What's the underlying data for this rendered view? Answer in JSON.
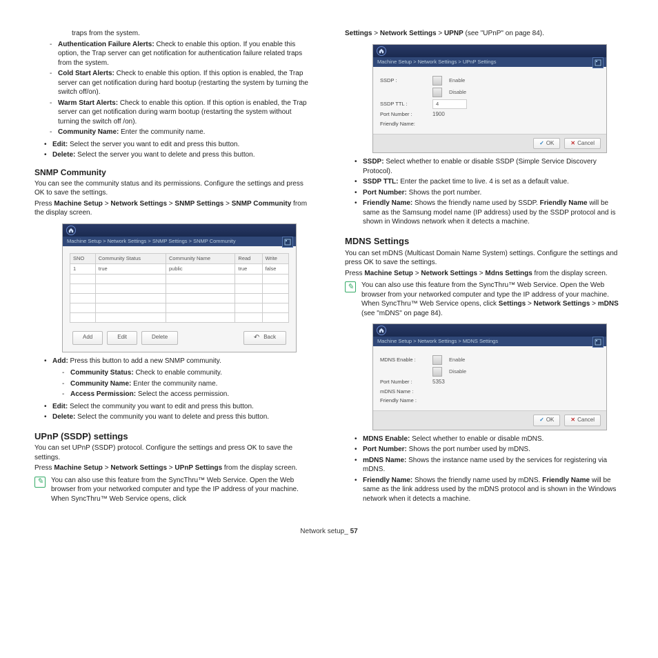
{
  "left": {
    "traps_from_system": "traps from the system.",
    "dash1": [
      {
        "b": "Authentication Failure Alerts:",
        "t": "  Check to enable this option. If you enable this option, the Trap server can get notification for authentication failure related traps from the system."
      },
      {
        "b": "Cold Start Alerts:",
        "t": "  Check to enable this option. If this option is enabled, the Trap server can get notification during hard bootup (restarting the system by turning the switch off/on)."
      },
      {
        "b": "Warm Start Alerts:",
        "t": "  Check to enable this option. If this option is enabled, the Trap server can get notification during warm bootup (restarting the system without turning the switch off /on)."
      },
      {
        "b": "Community Name:",
        "t": "  Enter the community name."
      }
    ],
    "bul1": [
      {
        "b": "Edit:",
        "t": "  Select the server you want to edit and press this button."
      },
      {
        "b": "Delete:",
        "t": "  Select the server you want to delete and press this button."
      }
    ],
    "snmp_h": "SNMP Community",
    "snmp_p1": "You can see the community status and its permissions. Configure the settings and press OK to save the settings.",
    "snmp_p2_pre": "Press ",
    "snmp_p2_b1": "Machine Setup",
    "snmp_p2_s1": " > ",
    "snmp_p2_b2": "Network Settings",
    "snmp_p2_s2": " > ",
    "snmp_p2_b3": "SNMP Settings",
    "snmp_p2_s3": " > ",
    "snmp_p2_b4": "SNMP Community",
    "snmp_p2_post": " from the display screen.",
    "snmp_mock": {
      "crumb": "Machine Setup  >  Network Settings  >  SNMP Settings  >  SNMP Community",
      "headers": [
        "SNO",
        "Community Status",
        "Community Name",
        "Read",
        "Write"
      ],
      "row1": [
        "1",
        "true",
        "public",
        "true",
        "false"
      ],
      "btns": [
        "Add",
        "Edit",
        "Delete"
      ],
      "back": "Back"
    },
    "bul2": [
      {
        "b": "Add:",
        "t": "  Press this button to add a new SNMP community."
      }
    ],
    "dash2": [
      {
        "b": "Community Status:",
        "t": "  Check to enable community."
      },
      {
        "b": "Community Name:",
        "t": "  Enter the community name."
      },
      {
        "b": "Access Permission:",
        "t": "  Select the access permission."
      }
    ],
    "bul3": [
      {
        "b": "Edit:",
        "t": "  Select the community you want to edit and press this button."
      },
      {
        "b": "Delete:",
        "t": "  Select the community you want to delete and press this button."
      }
    ],
    "upnp_h": "UPnP (SSDP) settings",
    "upnp_p1": "You can set UPnP (SSDP) protocol. Configure the settings and press OK to save the settings.",
    "upnp_p2_pre": "Press ",
    "upnp_p2_b1": "Machine Setup",
    "upnp_p2_s1": " > ",
    "upnp_p2_b2": "Network Settings",
    "upnp_p2_s2": " > ",
    "upnp_p2_b3": "UPnP Settings",
    "upnp_p2_post": " from the display screen.",
    "upnp_note": "You can also use this feature from the SyncThru™ Web Service. Open the Web browser from your networked computer and type the IP address of your machine. When SyncThru™ Web Service opens, click "
  },
  "right": {
    "top_b1": "Settings",
    "top_s1": " > ",
    "top_b2": "Network Settings",
    "top_s2": " > ",
    "top_b3": "UPNP",
    "top_post": " (see \"UPnP\" on page 84).",
    "upnp_mock": {
      "crumb": "Machine Setup  >  Network Settings  >  UPnP Settings",
      "rows": [
        {
          "label": "SSDP :",
          "opts": [
            "Enable",
            "Disable"
          ]
        },
        {
          "label": "SSDP TTL :",
          "val": "4"
        },
        {
          "label": "Port Number :",
          "val": "1900"
        },
        {
          "label": "Friendly Name:",
          "val": ""
        }
      ],
      "ok": "OK",
      "cancel": "Cancel"
    },
    "bul1": [
      {
        "b": "SSDP:",
        "t": "  Select whether to enable or disable SSDP (Simple Service Discovery Protocol)."
      },
      {
        "b": "SSDP TTL:",
        "t": "  Enter the packet time to live. 4 is set as a default value."
      },
      {
        "b": "Port Number:",
        "t": "  Shows the port number."
      },
      {
        "b": "Friendly Name:",
        "t": "  Shows the friendly name used by SSDP. ",
        "b2": "Friendly Name",
        "t2": " will be same as the Samsung model name (IP address) used by the SSDP protocol and is shown in Windows network when it detects a machine."
      }
    ],
    "mdns_h": "MDNS Settings",
    "mdns_p1": "You can set mDNS (Multicast Domain Name System) settings. Configure the settings and press OK to save the settings.",
    "mdns_p2_pre": "Press ",
    "mdns_p2_b1": "Machine Setup",
    "mdns_p2_s1": " > ",
    "mdns_p2_b2": "Network Settings",
    "mdns_p2_s2": " > ",
    "mdns_p2_b3": "Mdns Settings",
    "mdns_p2_post": " from the display screen.",
    "mdns_note_pre": "You can also use this feature from the SyncThru™ Web Service. Open the Web browser from your networked computer and type the IP address of your machine. When SyncThru™ Web Service opens, click ",
    "mdns_note_b1": "Settings",
    "mdns_note_s1": " > ",
    "mdns_note_b2": "Network Settings",
    "mdns_note_s2": " > ",
    "mdns_note_b3": "mDNS",
    "mdns_note_post": " (see \"mDNS\" on page 84).",
    "mdns_mock": {
      "crumb": "Machine Setup  >  Network Settings  >  MDNS Settings",
      "rows": [
        {
          "label": "MDNS Enable :",
          "opts": [
            "Enable",
            "Disable"
          ]
        },
        {
          "label": "Port Number :",
          "val": "5353"
        },
        {
          "label": "mDNS Name :",
          "val": ""
        },
        {
          "label": "Friendly Name :",
          "val": ""
        }
      ],
      "ok": "OK",
      "cancel": "Cancel"
    },
    "bul2": [
      {
        "b": "MDNS Enable:",
        "t": "  Select whether to enable or disable mDNS."
      },
      {
        "b": "Port Number:",
        "t": "  Shows the port number used by mDNS."
      },
      {
        "b": "mDNS Name: ",
        "t": "  Shows the instance name used by the services for registering via mDNS."
      },
      {
        "b": "Friendly Name:",
        "t": "  Shows the friendly name used by mDNS. ",
        "b2": "Friendly Name",
        "t2": " will be same as the link address used by the mDNS protocol and is shown in the Windows network when it detects a machine."
      }
    ]
  },
  "footer": {
    "label": "Network setup",
    "sep": "_ ",
    "page": "57"
  }
}
